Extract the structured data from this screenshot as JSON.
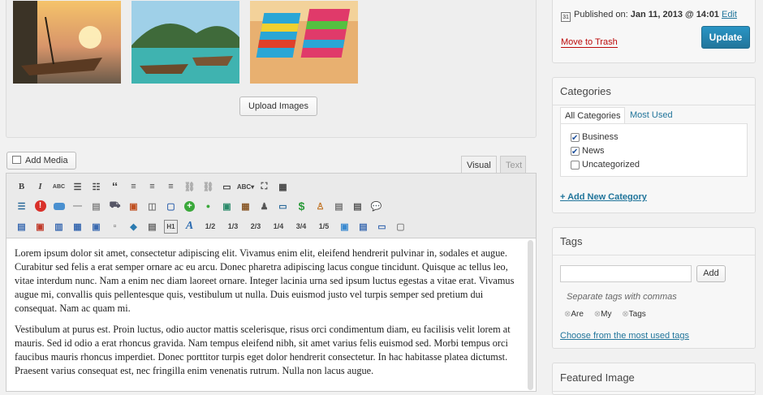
{
  "gallery": {
    "upload_label": "Upload Images"
  },
  "editor": {
    "add_media_label": "Add Media",
    "tab_visual": "Visual",
    "tab_text": "Text",
    "toolbar_fractions": [
      "1/2",
      "1/3",
      "2/3",
      "1/4",
      "3/4",
      "1/5"
    ],
    "paragraphs": [
      "Lorem ipsum dolor sit amet, consectetur adipiscing elit. Vivamus enim elit, eleifend hendrerit pulvinar in, sodales et augue. Curabitur sed felis a erat semper ornare ac eu arcu. Donec pharetra adipiscing lacus congue tincidunt. Quisque ac tellus leo, vitae interdum nunc. Nam a enim nec diam laoreet ornare. Integer lacinia urna sed ipsum luctus egestas a vitae erat. Vivamus augue mi, convallis quis pellentesque quis, vestibulum ut nulla. Duis euismod justo vel turpis semper sed pretium dui consequat. Nam ac quam mi.",
      "Vestibulum at purus est. Proin luctus, odio auctor mattis scelerisque, risus orci condimentum diam, eu facilisis velit lorem at mauris. Sed id odio a erat rhoncus gravida. Nam tempus eleifend nibh, sit amet varius felis euismod sed. Morbi tempus orci faucibus mauris rhoncus imperdiet. Donec porttitor turpis eget dolor hendrerit consectetur. In hac habitasse platea dictumst. Praesent varius consequat est, nec fringilla enim venenatis rutrum. Nulla non lacus augue."
    ]
  },
  "publish": {
    "published_label": "Published on:",
    "published_date": "Jan 11, 2013 @ 14:01",
    "edit_link": "Edit",
    "trash_label": "Move to Trash",
    "update_label": "Update"
  },
  "categories": {
    "title": "Categories",
    "tab_all": "All Categories",
    "tab_most_used": "Most Used",
    "items": [
      {
        "label": "Business",
        "checked": true
      },
      {
        "label": "News",
        "checked": true
      },
      {
        "label": "Uncategorized",
        "checked": false
      }
    ],
    "add_new": "+ Add New Category"
  },
  "tags": {
    "title": "Tags",
    "add_label": "Add",
    "hint": "Separate tags with commas",
    "items": [
      "Are",
      "My",
      "Tags"
    ],
    "choose_link": "Choose from the most used tags"
  },
  "featured": {
    "title": "Featured Image"
  },
  "colors": {
    "accent": "#21759b",
    "trash": "#bc0b0b",
    "update_bg": "#2a95c5"
  }
}
